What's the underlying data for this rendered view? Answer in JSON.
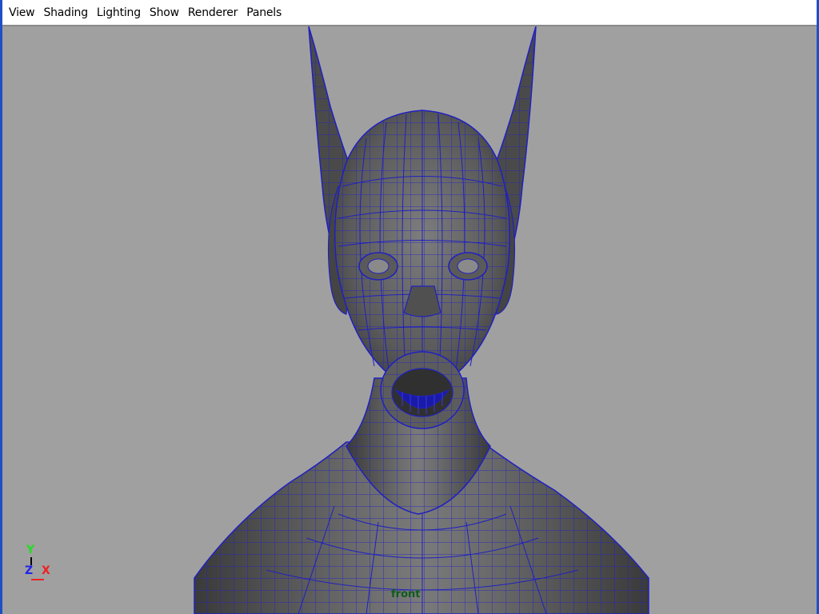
{
  "menubar": {
    "items": [
      {
        "label": "View"
      },
      {
        "label": "Shading"
      },
      {
        "label": "Lighting"
      },
      {
        "label": "Show"
      },
      {
        "label": "Renderer"
      },
      {
        "label": "Panels"
      }
    ]
  },
  "viewport": {
    "camera_label": "front",
    "background_color": "#a0a0a0",
    "wireframe_color": "#2020c0",
    "axis": {
      "y_label": "Y",
      "z_label": "Z",
      "x_label": "X"
    }
  }
}
